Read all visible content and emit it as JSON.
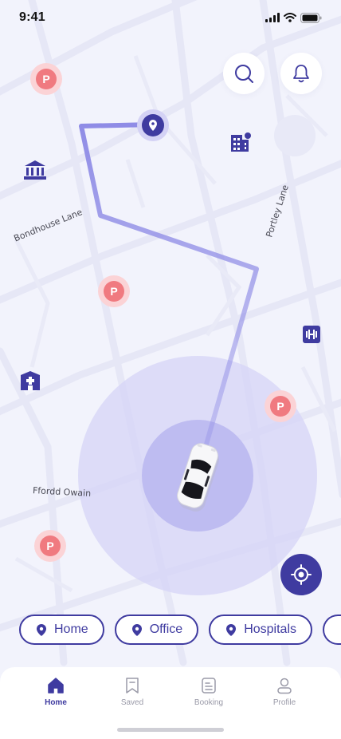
{
  "status_bar": {
    "time": "9:41"
  },
  "map": {
    "streets": [
      "Bondhouse Lane",
      "Portley Lane",
      "Ffordd Owain"
    ],
    "parking_label": "P",
    "route_color": "#8f8ce6",
    "accent": "#3f3ba0",
    "parking_color": "#f07a80"
  },
  "top_actions": {
    "search_icon": "search-icon",
    "notifications_icon": "bell-icon"
  },
  "quick_destinations": [
    {
      "label": "Home",
      "icon": "location-pin-icon"
    },
    {
      "label": "Office",
      "icon": "location-pin-icon"
    },
    {
      "label": "Hospitals",
      "icon": "location-pin-icon"
    }
  ],
  "tab_bar": {
    "items": [
      {
        "label": "Home",
        "icon": "home-icon",
        "active": true
      },
      {
        "label": "Saved",
        "icon": "bookmark-icon",
        "active": false
      },
      {
        "label": "Booking",
        "icon": "document-icon",
        "active": false
      },
      {
        "label": "Profile",
        "icon": "user-icon",
        "active": false
      }
    ]
  }
}
